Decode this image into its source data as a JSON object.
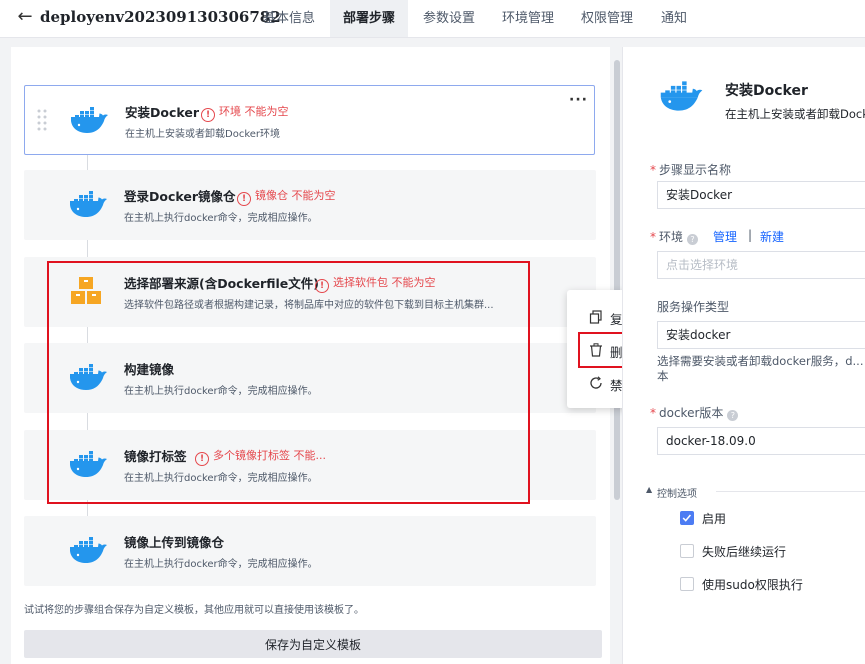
{
  "header": {
    "title": "deployenv202309130306782",
    "tabs": [
      {
        "label": "基本信息"
      },
      {
        "label": "部署步骤",
        "active": true
      },
      {
        "label": "参数设置"
      },
      {
        "label": "环境管理"
      },
      {
        "label": "权限管理"
      },
      {
        "label": "通知"
      }
    ]
  },
  "steps": [
    {
      "title": "安装Docker",
      "error": "环境 不能为空",
      "desc": "在主机上安装或者卸载Docker环境",
      "icon": "docker-icon"
    },
    {
      "title": "登录Docker镜像仓",
      "error": "镜像仓 不能为空",
      "desc": "在主机上执行docker命令，完成相应操作。",
      "icon": "docker-icon"
    },
    {
      "title": "选择部署来源(含Dockerfile文件)",
      "error": "选择软件包 不能为空",
      "desc": "选择软件包路径或者根据构建记录，将制品库中对应的软件包下载到目标主机集群...",
      "icon": "package-icon"
    },
    {
      "title": "构建镜像",
      "error": "",
      "desc": "在主机上执行docker命令，完成相应操作。",
      "icon": "docker-icon"
    },
    {
      "title": "镜像打标签",
      "error": "多个镜像打标签 不能...",
      "desc": "在主机上执行docker命令，完成相应操作。",
      "icon": "docker-icon"
    },
    {
      "title": "镜像上传到镜像仓",
      "error": "",
      "desc": "在主机上执行docker命令，完成相应操作。",
      "icon": "docker-icon"
    }
  ],
  "hint": "试试将您的步骤组合保存为自定义模板，其他应用就可以直接使用该模板了。",
  "save_template_label": "保存为自定义模板",
  "context_menu": {
    "items": [
      {
        "label": "复制",
        "icon": "copy-icon"
      },
      {
        "label": "删除",
        "icon": "trash-icon"
      },
      {
        "label": "禁用",
        "icon": "disable-icon"
      }
    ]
  },
  "detail": {
    "title": "安装Docker",
    "desc": "在主机上安装或者卸载Docker环境",
    "display_name": {
      "label": "步骤显示名称",
      "value": "安装Docker"
    },
    "env": {
      "label": "环境",
      "manage": "管理",
      "sep": "|",
      "create": "新建",
      "placeholder": "点击选择环境"
    },
    "service_op": {
      "label": "服务操作类型",
      "value": "安装docker",
      "help": "选择需要安装或者卸载docker服务，d...本"
    },
    "docker_version": {
      "label": "docker版本",
      "value": "docker-18.09.0"
    },
    "control": {
      "title": "控制选项",
      "options": [
        {
          "label": "启用",
          "checked": true
        },
        {
          "label": "失败后继续运行",
          "checked": false
        },
        {
          "label": "使用sudo权限执行",
          "checked": false
        }
      ]
    }
  },
  "colors": {
    "accent": "#1664ff",
    "error": "#e5484d",
    "docker": "#2496ed",
    "highlight": "#e0121f"
  }
}
